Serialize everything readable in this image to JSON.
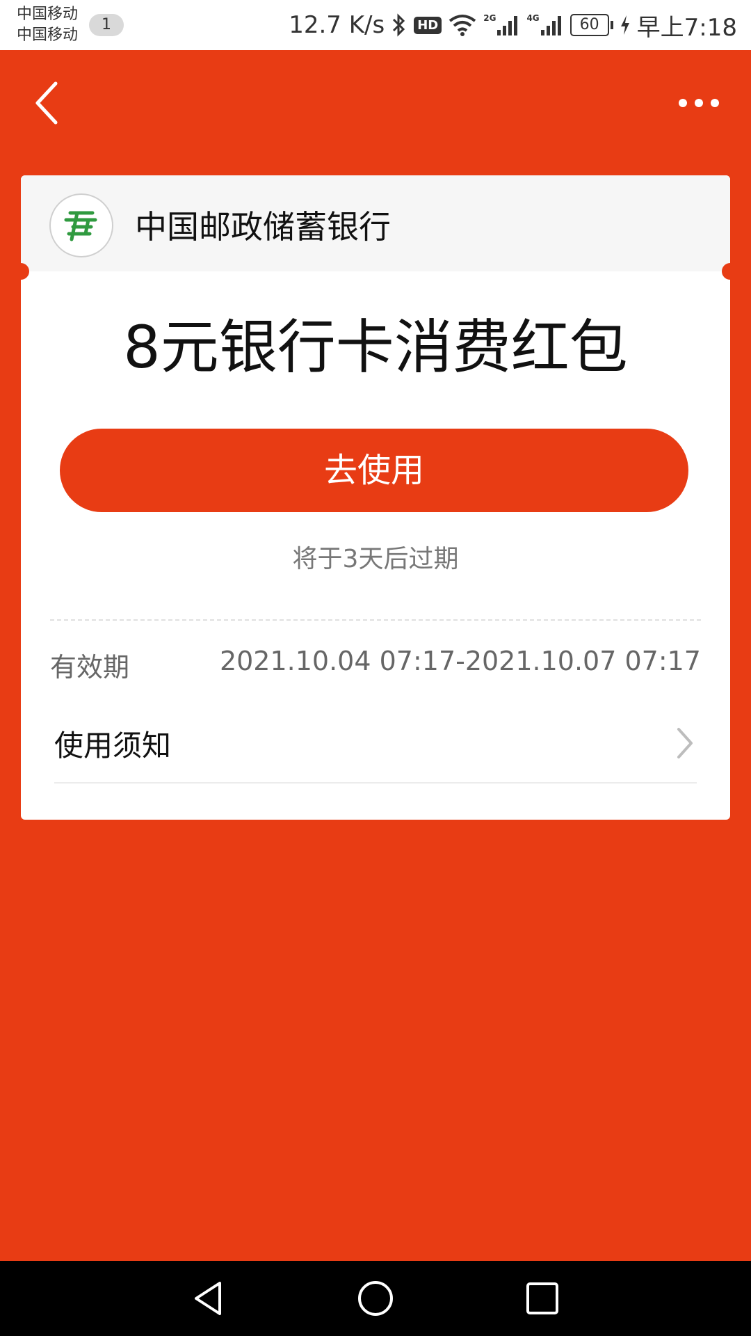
{
  "status_bar": {
    "carrier1": "中国移动",
    "carrier2": "中国移动",
    "notification_count": "1",
    "network_speed": "12.7 K/s",
    "hd_label": "HD",
    "sim1_type": "2G",
    "sim2_type": "4G",
    "battery_level": "60",
    "time": "早上7:18",
    "icons": [
      "bluetooth-icon",
      "hd-icon",
      "wifi-icon",
      "signal-icon",
      "signal-icon",
      "battery-icon",
      "charging-icon"
    ]
  },
  "nav": {
    "icons": [
      "back-icon",
      "more-icon"
    ]
  },
  "card": {
    "bank_name": "中国邮政储蓄银行",
    "title": "8元银行卡消费红包",
    "use_button_label": "去使用",
    "expire_note": "将于3天后过期",
    "validity_label": "有效期",
    "validity_value": "2021.10.04 07:17-2021.10.07 07:17",
    "notice_label": "使用须知"
  },
  "colors": {
    "accent": "#e83c14",
    "card_bg": "#ffffff",
    "header_bg": "#f6f6f6",
    "logo_green": "#2f9a3f"
  },
  "system_nav": {
    "icons": [
      "nav-back-icon",
      "nav-home-icon",
      "nav-recents-icon"
    ]
  }
}
